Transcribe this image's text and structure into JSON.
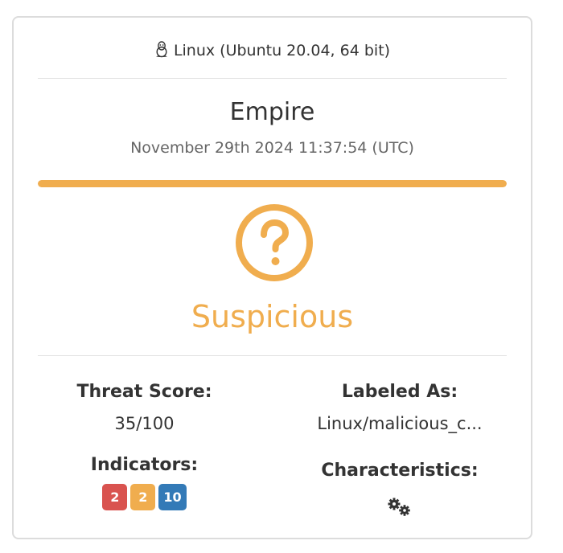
{
  "environment": {
    "os_icon": "linux-tux-icon",
    "label": "Linux (Ubuntu 20.04, 64 bit)"
  },
  "report": {
    "title": "Empire",
    "timestamp": "November 29th 2024 11:37:54 (UTC)",
    "progress_color": "#f0ad4e",
    "progress_fraction": 1.0,
    "verdict": "Suspicious",
    "verdict_icon": "question-circle-icon",
    "verdict_color": "#f0ad4e"
  },
  "stats": {
    "threat_score_label": "Threat Score:",
    "threat_score_value": "35/100",
    "labeled_as_label": "Labeled As:",
    "labeled_as_value": "Linux/malicious_c...",
    "indicators_label": "Indicators:",
    "indicators": [
      {
        "count": "2",
        "color": "#d9534f",
        "level": "malicious"
      },
      {
        "count": "2",
        "color": "#f0ad4e",
        "level": "suspicious"
      },
      {
        "count": "10",
        "color": "#337ab7",
        "level": "informative"
      }
    ],
    "characteristics_label": "Characteristics:",
    "characteristics_icon": "gears-icon"
  }
}
